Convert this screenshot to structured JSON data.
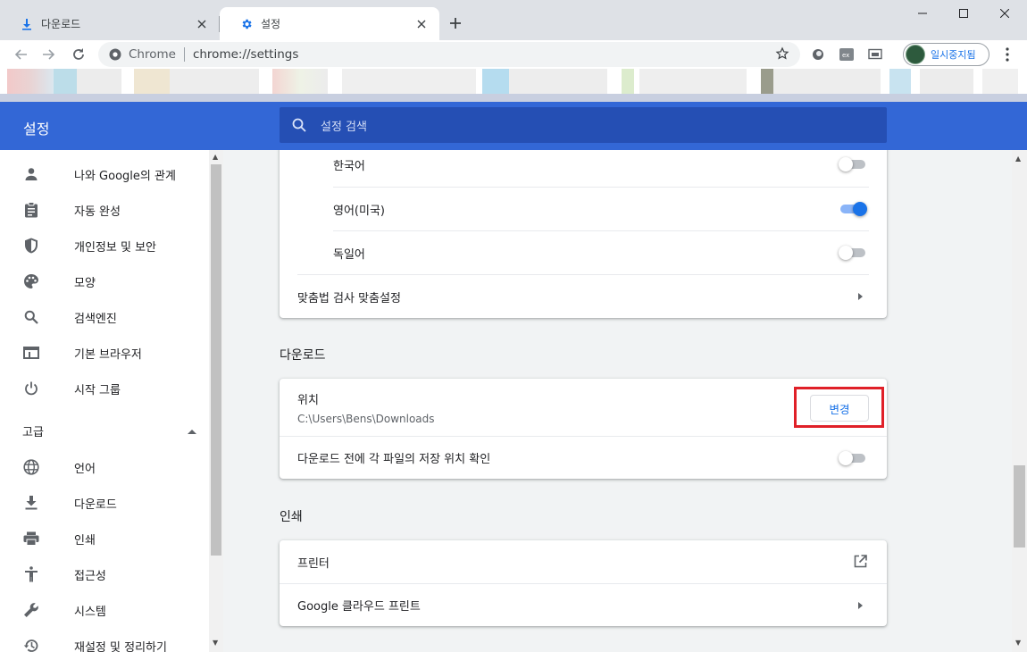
{
  "tabs": [
    {
      "label": "다운로드",
      "icon": "download-icon"
    },
    {
      "label": "설정",
      "icon": "gear-icon"
    }
  ],
  "omnibox": {
    "site": "Chrome",
    "url": "chrome://settings"
  },
  "profile": {
    "label": "일시중지됨"
  },
  "header": {
    "title": "설정",
    "search_placeholder": "설정 검색"
  },
  "sidebar": {
    "items": [
      {
        "label": "나와 Google의 관계",
        "icon": "person-icon"
      },
      {
        "label": "자동 완성",
        "icon": "clipboard-icon"
      },
      {
        "label": "개인정보 및 보안",
        "icon": "shield-icon"
      },
      {
        "label": "모양",
        "icon": "palette-icon"
      },
      {
        "label": "검색엔진",
        "icon": "search-icon"
      },
      {
        "label": "기본 브라우저",
        "icon": "browser-window-icon"
      },
      {
        "label": "시작 그룹",
        "icon": "power-icon"
      }
    ],
    "advanced_label": "고급",
    "advanced_items": [
      {
        "label": "언어",
        "icon": "globe-icon"
      },
      {
        "label": "다운로드",
        "icon": "download-icon"
      },
      {
        "label": "인쇄",
        "icon": "printer-icon"
      },
      {
        "label": "접근성",
        "icon": "accessibility-icon"
      },
      {
        "label": "시스템",
        "icon": "wrench-icon"
      },
      {
        "label": "재설정 및 정리하기",
        "icon": "history-icon"
      }
    ]
  },
  "languages": {
    "items": [
      {
        "label": "한국어",
        "enabled": false
      },
      {
        "label": "영어(미국)",
        "enabled": true
      },
      {
        "label": "독일어",
        "enabled": false
      }
    ],
    "spellcheck_label": "맞춤법 검사 맞춤설정"
  },
  "downloads": {
    "section_title": "다운로드",
    "location_label": "위치",
    "location_path": "C:\\Users\\Bens\\Downloads",
    "change_button": "변경",
    "ask_label": "다운로드 전에 각 파일의 저장 위치 확인",
    "ask_enabled": false
  },
  "printing": {
    "section_title": "인쇄",
    "printers_label": "프린터",
    "cloud_print_label": "Google 클라우드 프린트"
  },
  "colors": {
    "accent": "#1a73e8",
    "header": "#3367d6",
    "highlight": "#e02028"
  }
}
